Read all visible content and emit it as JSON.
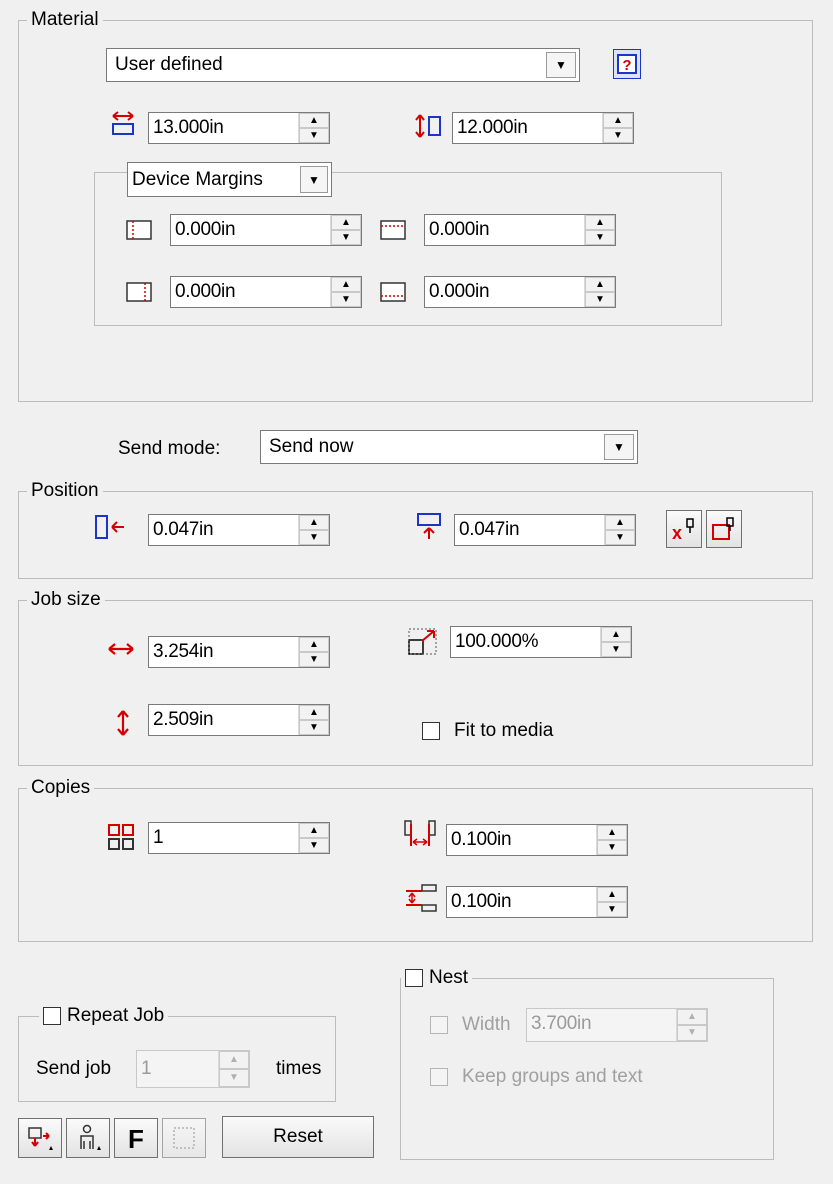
{
  "material": {
    "legend": "Material",
    "media_value": "User defined",
    "width": "13.000in",
    "height": "12.000in",
    "margins_label": "Device Margins",
    "margin_left": "0.000in",
    "margin_top": "0.000in",
    "margin_right": "0.000in",
    "margin_bottom": "0.000in"
  },
  "send_mode": {
    "label": "Send mode:",
    "value": "Send now"
  },
  "position": {
    "legend": "Position",
    "x": "0.047in",
    "y": "0.047in"
  },
  "job_size": {
    "legend": "Job size",
    "width": "3.254in",
    "height": "2.509in",
    "scale": "100.000%",
    "fit_label": "Fit to media"
  },
  "copies": {
    "legend": "Copies",
    "count": "1",
    "h_spacing": "0.100in",
    "v_spacing": "0.100in"
  },
  "repeat_job": {
    "legend": "Repeat Job",
    "send_label": "Send job",
    "times_value": "1",
    "times_label": "times"
  },
  "nest": {
    "legend": "Nest",
    "width_label": "Width",
    "width_value": "3.700in",
    "keep_label": "Keep groups and text"
  },
  "toolbar": {
    "reset_label": "Reset"
  },
  "colors": {
    "accent_red": "#d40000",
    "accent_blue": "#1a35c8"
  }
}
